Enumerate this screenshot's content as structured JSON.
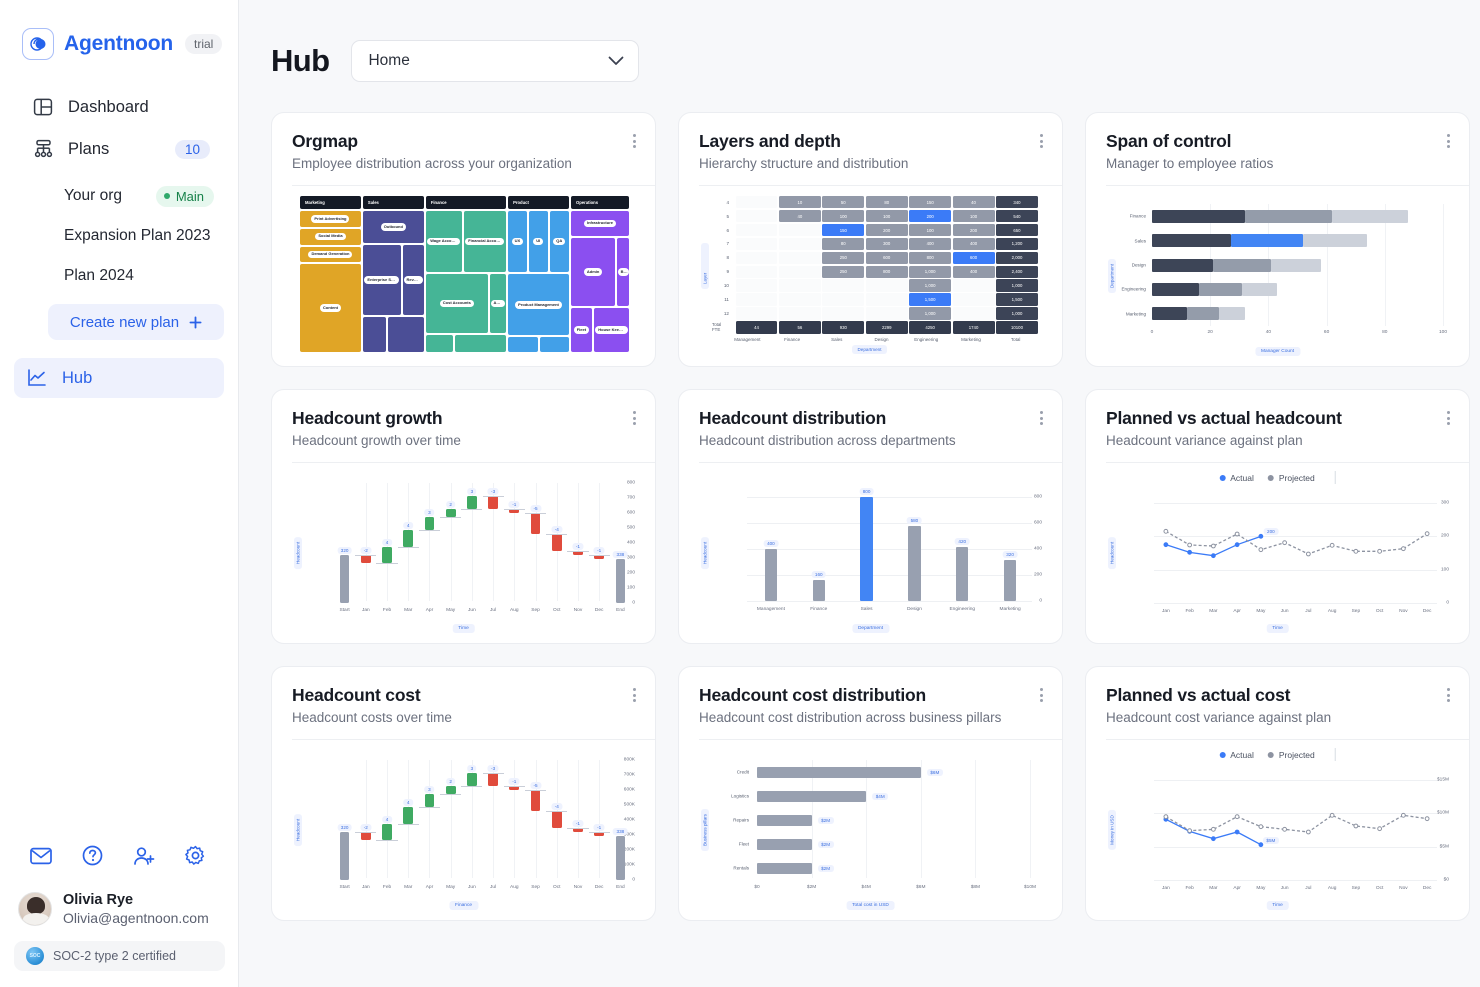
{
  "brand": {
    "name": "Agentnoon",
    "trial_label": "trial"
  },
  "sidebar": {
    "nav": [
      {
        "label": "Dashboard",
        "icon": "dashboard-icon"
      },
      {
        "label": "Plans",
        "icon": "plans-icon",
        "count": "10"
      }
    ],
    "plans": [
      {
        "label": "Your org",
        "pill": "Main"
      },
      {
        "label": "Expansion Plan 2023"
      },
      {
        "label": "Plan 2024"
      }
    ],
    "create_plan_label": "Create new plan",
    "hub_label": "Hub",
    "footer_icons": [
      "mail-icon",
      "help-icon",
      "invite-user-icon",
      "settings-icon"
    ],
    "user": {
      "name": "Olivia Rye",
      "email": "Olivia@agentnoon.com"
    },
    "certification": "SOC-2 type 2 certified"
  },
  "header": {
    "title": "Hub",
    "select_value": "Home"
  },
  "cards": [
    {
      "title": "Orgmap",
      "subtitle": "Employee distribution across your organization"
    },
    {
      "title": "Layers and depth",
      "subtitle": "Hierarchy structure and distribution"
    },
    {
      "title": "Span of control",
      "subtitle": "Manager to employee ratios"
    },
    {
      "title": "Headcount growth",
      "subtitle": "Headcount growth over time"
    },
    {
      "title": "Headcount distribution",
      "subtitle": "Headcount distribution across departments"
    },
    {
      "title": "Planned vs actual headcount",
      "subtitle": "Headcount variance against plan"
    },
    {
      "title": "Headcount cost",
      "subtitle": "Headcount costs over time"
    },
    {
      "title": "Headcount cost distribution",
      "subtitle": "Headcount cost distribution across business pillars"
    },
    {
      "title": "Planned vs actual cost",
      "subtitle": "Headcount cost variance against plan"
    }
  ],
  "chart_data": [
    {
      "type": "treemap",
      "title": "Orgmap",
      "groups": [
        {
          "name": "Marketing",
          "color": "#e0a526",
          "weight": 1.05,
          "children": [
            {
              "label": "Print Advertising",
              "h": 11
            },
            {
              "label": "Social Media",
              "h": 11
            },
            {
              "label": "Demand Generation",
              "h": 11
            },
            {
              "label": "Content",
              "h": 61
            }
          ]
        },
        {
          "name": "Sales",
          "color": "#4b4e96",
          "weight": 1.05,
          "children": [
            {
              "label": "Outbound",
              "h": 22
            },
            {
              "label": "Enterprise Sales",
              "h": 48,
              "split": [
                {
                  "label": "Enterprise Sales",
                  "w": 72
                },
                {
                  "label": "RevOps",
                  "w": 28
                }
              ]
            },
            {
              "label": "",
              "h": 24,
              "split": [
                {
                  "label": "",
                  "w": 40
                },
                {
                  "label": "",
                  "w": 60
                }
              ]
            }
          ]
        },
        {
          "name": "Finance",
          "color": "#45b596",
          "weight": 1.1,
          "children": [
            {
              "label": "Wage Accounts",
              "h": 42,
              "split": [
                {
                  "label": "Wage Accounts",
                  "w": 30
                },
                {
                  "label": "Financial Accounts",
                  "w": 70
                }
              ]
            },
            {
              "label": "Cost Accounts",
              "h": 40,
              "split": [
                {
                  "label": "Cost Accounts",
                  "w": 80
                },
                {
                  "label": "Audit",
                  "w": 20
                }
              ]
            },
            {
              "label": "",
              "h": 12,
              "split": [
                {
                  "label": "",
                  "w": 35
                },
                {
                  "label": "",
                  "w": 65
                }
              ]
            }
          ]
        },
        {
          "name": "Product",
          "color": "#42a0e8",
          "weight": 1.05,
          "children": [
            {
              "label": "",
              "h": 42,
              "split": [
                {
                  "label": "UX",
                  "w": 33
                },
                {
                  "label": "UI",
                  "w": 33
                },
                {
                  "label": "QA",
                  "w": 34
                }
              ]
            },
            {
              "label": "Product Management",
              "h": 42
            },
            {
              "label": "",
              "h": 10,
              "split": [
                {
                  "label": "",
                  "w": 50
                },
                {
                  "label": "",
                  "w": 50
                }
              ]
            }
          ]
        },
        {
          "name": "Operations",
          "color": "#8b4ff0",
          "weight": 1.0,
          "children": [
            {
              "label": "Infrastructure",
              "h": 17
            },
            {
              "label": "Admin",
              "h": 47,
              "split": [
                {
                  "label": "Admin",
                  "w": 80
                },
                {
                  "label": "BD",
                  "w": 20
                }
              ]
            },
            {
              "label": "",
              "h": 30,
              "split": [
                {
                  "label": "Fleet",
                  "w": 42
                },
                {
                  "label": "House Keeping",
                  "w": 58
                }
              ]
            }
          ]
        }
      ]
    },
    {
      "type": "heatmap",
      "title": "Layers and depth",
      "ylabel": "Layer",
      "xlabel": "Department",
      "columns": [
        "Management",
        "Finance",
        "Sales",
        "Design",
        "Engineering",
        "Marketing",
        "Total"
      ],
      "rows": [
        "4",
        "5",
        "6",
        "7",
        "8",
        "9",
        "10",
        "11",
        "12"
      ],
      "total_row_label": "Total FTE",
      "cells": [
        [
          null,
          10,
          50,
          80,
          150,
          40,
          340
        ],
        [
          null,
          40,
          100,
          100,
          200,
          100,
          540
        ],
        [
          null,
          null,
          150,
          200,
          100,
          200,
          650
        ],
        [
          null,
          null,
          80,
          300,
          400,
          400,
          1200
        ],
        [
          null,
          null,
          250,
          600,
          800,
          600,
          2000
        ],
        [
          null,
          null,
          250,
          800,
          1000,
          400,
          2400
        ],
        [
          null,
          null,
          null,
          null,
          1000,
          null,
          1000
        ],
        [
          null,
          null,
          null,
          null,
          1500,
          null,
          1500
        ],
        [
          null,
          null,
          null,
          null,
          1000,
          null,
          1000
        ]
      ],
      "highlight": [
        [
          1,
          4
        ],
        [
          2,
          2
        ],
        [
          4,
          5
        ],
        [
          7,
          4
        ]
      ],
      "totals": [
        "44",
        "56",
        "930",
        "2299",
        "4250",
        "1740",
        "10100"
      ]
    },
    {
      "type": "bar",
      "orientation": "horizontal",
      "title": "Span of control",
      "ylabel": "Department",
      "xlabel": "Manager Count",
      "categories": [
        "Finance",
        "Sales",
        "Design",
        "Engineering",
        "Marketing"
      ],
      "xticks": [
        "0",
        "20",
        "40",
        "60",
        "80",
        "100"
      ],
      "xlim": [
        0,
        100
      ],
      "series": [
        {
          "name": "segment1",
          "color": "#3d4557",
          "values": [
            32,
            27,
            21,
            16,
            12
          ]
        },
        {
          "name": "segment2",
          "color": "#949caa",
          "values": [
            30,
            25,
            20,
            15,
            11
          ]
        },
        {
          "name": "segment3",
          "color": "#ccd1da",
          "values": [
            26,
            22,
            17,
            12,
            9
          ]
        }
      ],
      "highlight_bar": {
        "category": "Sales",
        "segment": 1,
        "color": "#4285f4"
      }
    },
    {
      "type": "waterfall",
      "title": "Headcount growth",
      "ylabel": "Headcount",
      "xlabel": "Time",
      "categories": [
        "Start",
        "Jan",
        "Feb",
        "Mar",
        "Apr",
        "May",
        "Jun",
        "Jul",
        "Aug",
        "Sep",
        "Oct",
        "Nov",
        "Dec",
        "End"
      ],
      "yticks": [
        "0",
        "100",
        "200",
        "300",
        "400",
        "500",
        "600",
        "700",
        "800"
      ],
      "ylim": [
        0,
        800
      ],
      "start_value": 320,
      "end_value": 338,
      "start_label": "320",
      "end_label": "338",
      "deltas": [
        -2,
        4,
        4,
        3,
        2,
        3,
        -3,
        -1,
        -5,
        -4,
        -1,
        -1
      ],
      "delta_labels": [
        "-2",
        "4",
        "4",
        "3",
        "2",
        "3",
        "-3",
        "-1",
        "-5",
        "-4",
        "-1",
        "-1"
      ]
    },
    {
      "type": "bar",
      "orientation": "vertical",
      "title": "Headcount distribution",
      "ylabel": "Headcount",
      "xlabel": "Department",
      "categories": [
        "Management",
        "Finance",
        "Sales",
        "Design",
        "Engineering",
        "Marketing"
      ],
      "values": [
        400,
        160,
        800,
        580,
        420,
        320
      ],
      "value_labels": [
        "400",
        "160",
        "800",
        "580",
        "420",
        "320"
      ],
      "yticks": [
        "0",
        "200",
        "400",
        "600",
        "800"
      ],
      "ylim": [
        0,
        850
      ],
      "highlight_index": 2,
      "bar_color": "#98a0b0",
      "highlight_color": "#4285f4"
    },
    {
      "type": "line",
      "title": "Planned vs actual headcount",
      "ylabel": "Headcount",
      "xlabel": "Time",
      "legend": [
        "Actual",
        "Projected"
      ],
      "legend_position": "top",
      "categories": [
        "Jan",
        "Feb",
        "Mar",
        "Apr",
        "May",
        "Jun",
        "Jul",
        "Aug",
        "Sep",
        "Oct",
        "Nov",
        "Dec"
      ],
      "yticks": [
        "0",
        "100",
        "200",
        "300"
      ],
      "ylim": [
        0,
        300
      ],
      "series": [
        {
          "name": "Actual",
          "color": "#3b7bf7",
          "style": "solid",
          "values": [
            175,
            152,
            142,
            175,
            200,
            null,
            null,
            null,
            null,
            null,
            null,
            null
          ]
        },
        {
          "name": "Projected",
          "color": "#8d93a1",
          "style": "dashed",
          "values": [
            215,
            174,
            171,
            207,
            160,
            181,
            147,
            173,
            155,
            155,
            163,
            208
          ]
        }
      ],
      "point_label": {
        "category": "May",
        "text": "200"
      }
    },
    {
      "type": "waterfall",
      "title": "Headcount cost",
      "ylabel": "Headcount",
      "xlabel": "Finance",
      "categories": [
        "Start",
        "Jan",
        "Feb",
        "Mar",
        "Apr",
        "May",
        "Jun",
        "Jul",
        "Aug",
        "Sep",
        "Oct",
        "Nov",
        "Dec",
        "End"
      ],
      "yticks": [
        "0",
        "100K",
        "200K",
        "300K",
        "400K",
        "500K",
        "600K",
        "700K",
        "800K"
      ],
      "ylim": [
        0,
        800
      ],
      "start_value": 320,
      "end_value": 338,
      "start_label": "320",
      "end_label": "338",
      "deltas": [
        -2,
        4,
        4,
        3,
        2,
        3,
        -3,
        -1,
        -5,
        -4,
        -1,
        -1
      ],
      "delta_labels": [
        "-2",
        "4",
        "4",
        "3",
        "2",
        "3",
        "-3",
        "-1",
        "-5",
        "-4",
        "-1",
        "-1"
      ]
    },
    {
      "type": "bar",
      "orientation": "horizontal",
      "title": "Headcount cost distribution",
      "ylabel": "Business pillars",
      "xlabel": "Total cost in USD",
      "categories": [
        "Credit",
        "Logistics",
        "Repairs",
        "Fleet",
        "Rentals"
      ],
      "values": [
        6,
        4,
        2,
        2,
        2
      ],
      "value_labels": [
        "$6M",
        "$4M",
        "$2M",
        "$2M",
        "$2M"
      ],
      "xticks": [
        "$0",
        "$2M",
        "$4M",
        "$6M",
        "$8M",
        "$10M"
      ],
      "xlim": [
        0,
        10
      ],
      "bar_color": "#98a0b0"
    },
    {
      "type": "line",
      "title": "Planned vs actual cost",
      "ylabel": "Money in USD",
      "xlabel": "Time",
      "legend": [
        "Actual",
        "Projected"
      ],
      "legend_position": "top",
      "categories": [
        "Jan",
        "Feb",
        "Mar",
        "Apr",
        "May",
        "Jun",
        "Jul",
        "Aug",
        "Sep",
        "Oct",
        "Nov",
        "Dec"
      ],
      "yticks": [
        "$0",
        "$5M",
        "$10M",
        "$15M"
      ],
      "ylim": [
        0,
        15
      ],
      "series": [
        {
          "name": "Actual",
          "color": "#3b7bf7",
          "style": "solid",
          "values": [
            9.1,
            7.3,
            6.2,
            7.2,
            5.3,
            null,
            null,
            null,
            null,
            null,
            null,
            null
          ]
        },
        {
          "name": "Projected",
          "color": "#8d93a1",
          "style": "dashed",
          "values": [
            9.5,
            7.4,
            7.6,
            9.5,
            8.0,
            7.6,
            7.2,
            9.7,
            8.1,
            7.7,
            9.7,
            9.2
          ]
        }
      ],
      "point_label": {
        "category": "May",
        "text": "$5M"
      }
    }
  ],
  "colors": {
    "accent": "#2b62e8",
    "blue": "#4285f4",
    "green": "#3faa62",
    "red": "#e04b3c",
    "grey": "#98a0b0"
  }
}
